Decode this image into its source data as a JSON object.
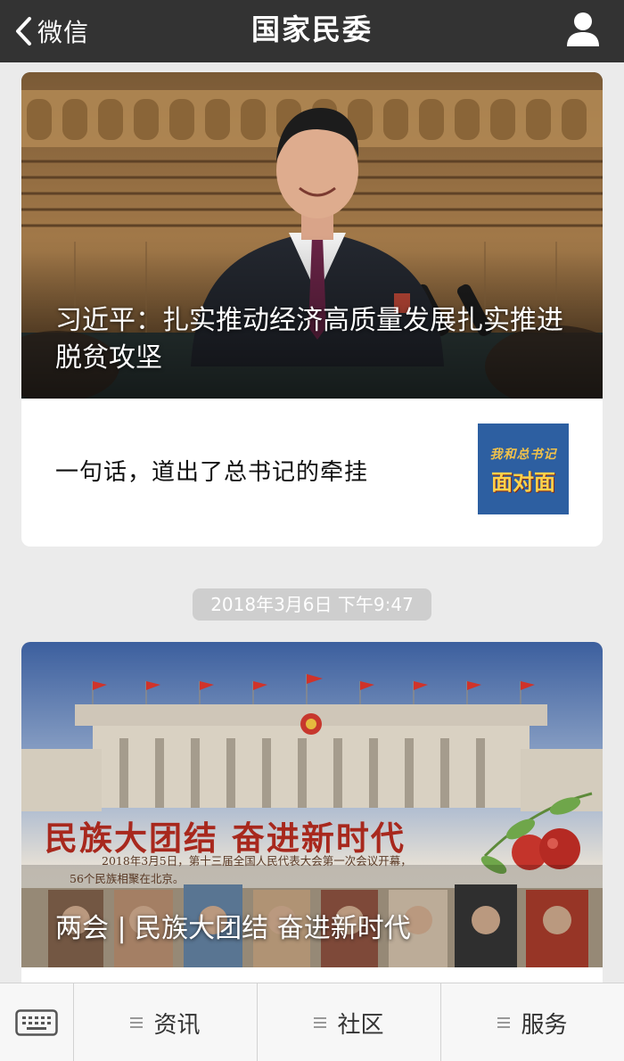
{
  "nav": {
    "back_label": "微信",
    "title": "国家民委"
  },
  "feed": {
    "card1": {
      "cover_title": "习近平：扎实推动经济高质量发展扎实推进脱贫攻坚",
      "sub_title": "一句话，道出了总书记的牵挂",
      "thumb_text_top": "我和总书记",
      "thumb_text_main": "面对面"
    },
    "timestamp": "2018年3月6日 下午9:47",
    "card2": {
      "cover_heading": "民族大团结 奋进新时代",
      "cover_caption_line1": "2018年3月5日，第十三届全国人民代表大会第一次会议开幕，",
      "cover_caption_line2": "56个民族相聚在北京。",
      "cover_title": "两会 | 民族大团结 奋进新时代"
    }
  },
  "menu": {
    "items": [
      {
        "label": "资讯"
      },
      {
        "label": "社区"
      },
      {
        "label": "服务"
      }
    ]
  },
  "colors": {
    "navbar": "#333333",
    "page_bg": "#ebebeb",
    "timestamp_bg": "#cecece",
    "menu_bg": "#f7f7f7"
  }
}
